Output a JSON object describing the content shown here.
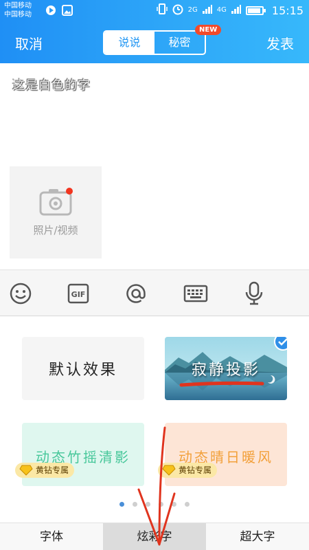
{
  "status_bar": {
    "carrier_1": "中国移动",
    "carrier_2": "中国移动",
    "net_1": "2G",
    "net_2": "4G",
    "time": "15:15"
  },
  "header": {
    "cancel_label": "取消",
    "publish_label": "发表",
    "tab_post": "说说",
    "tab_secret": "秘密",
    "new_badge": "NEW"
  },
  "compose": {
    "text": "这是白色的字",
    "photo_label": "照片/视频"
  },
  "toolbar": {
    "icons": [
      "emoji-icon",
      "gif-icon",
      "at-icon",
      "keyboard-icon",
      "microphone-icon"
    ]
  },
  "effects": {
    "default_label": "默认效果",
    "silent_label": "寂静投影",
    "bamboo_label": "动态竹摇清影",
    "sunny_label": "动态晴日暖风",
    "vip_label": "黄钻专属",
    "page_count": 6,
    "current_page": 1
  },
  "tabs": {
    "font": "字体",
    "colorful": "炫彩字",
    "big": "超大字"
  },
  "colors": {
    "header_gradient_start": "#1f8ff5",
    "header_gradient_end": "#37b8fb",
    "accent_red": "#e0341e",
    "bamboo_text": "#47c79a",
    "sunny_text": "#f2a03a"
  }
}
